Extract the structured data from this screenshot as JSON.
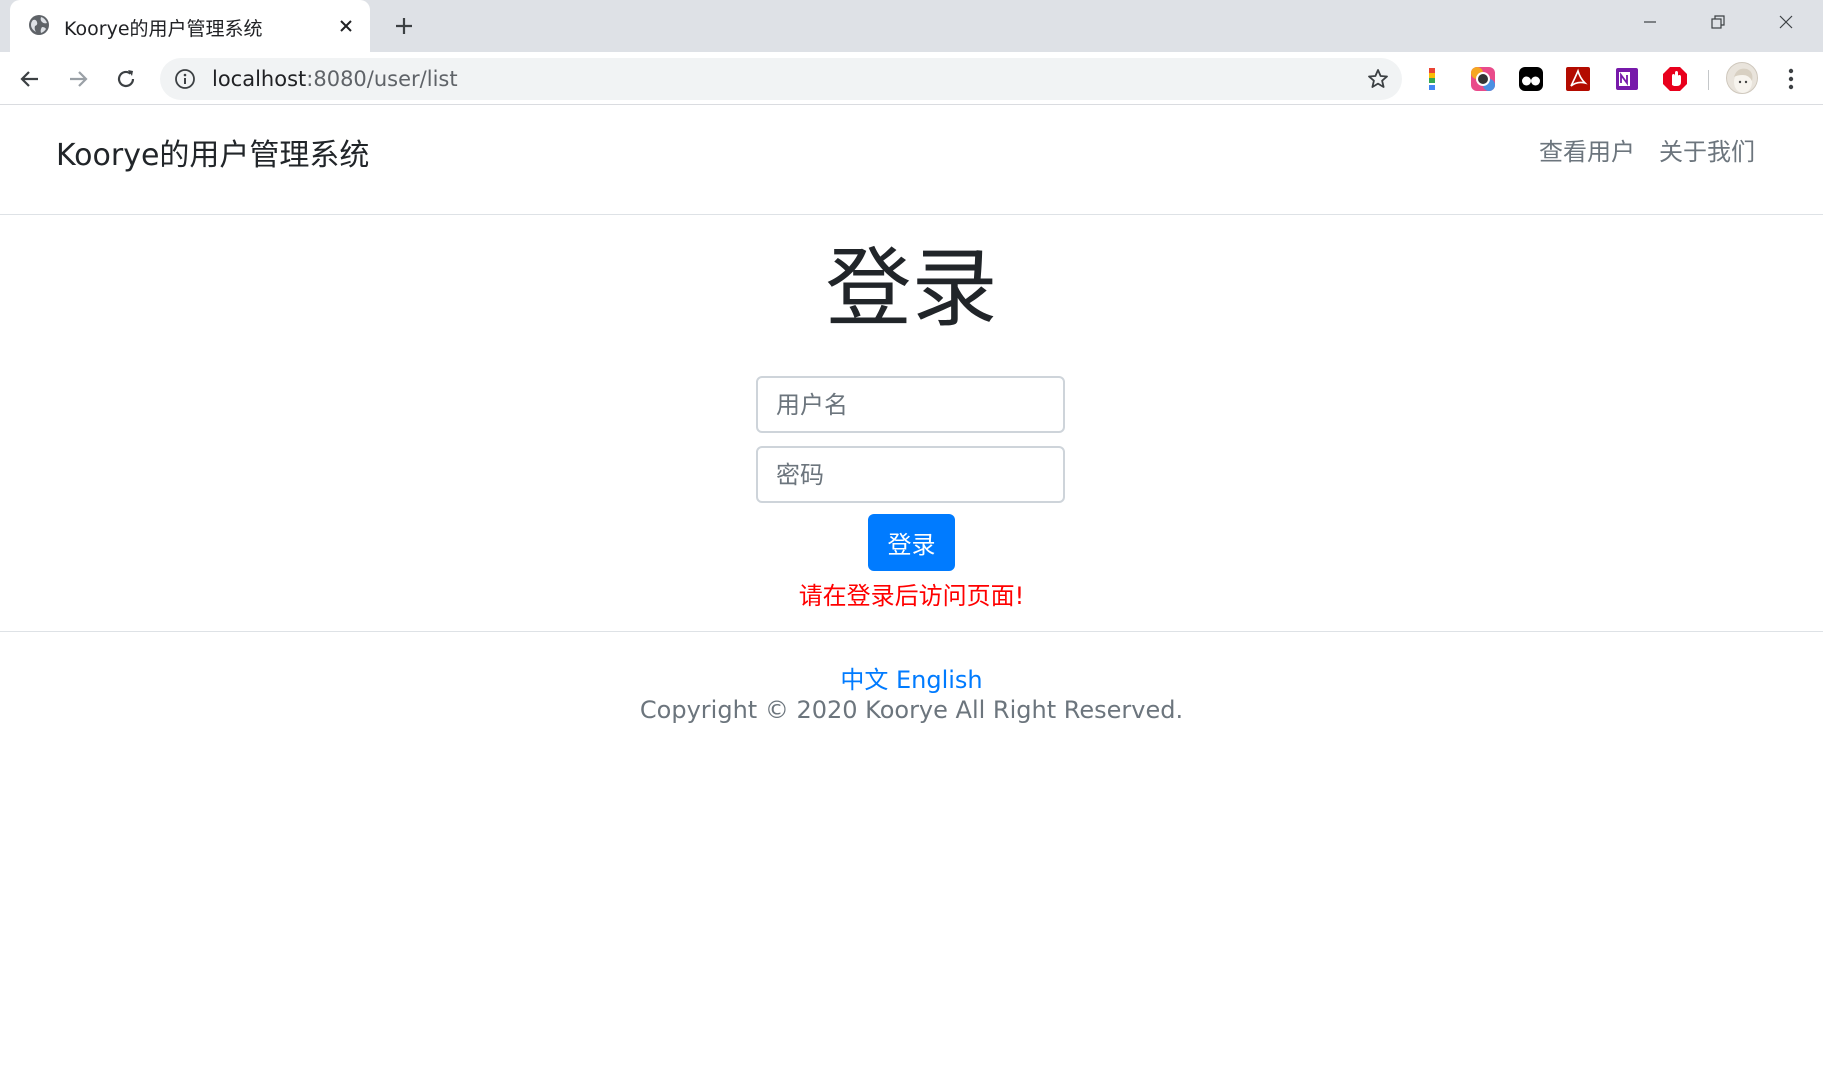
{
  "browser": {
    "tab": {
      "title": "Koorye的用户管理系统",
      "favicon": "globe-icon",
      "close_icon": "close-icon"
    },
    "new_tab_icon": "plus-icon",
    "window_controls": [
      "minimize-icon",
      "restore-icon",
      "close-window-icon"
    ],
    "nav": {
      "back": "arrow-left-icon",
      "forward": "arrow-right-icon",
      "reload": "reload-icon"
    },
    "omnibox": {
      "host": "localhost",
      "rest": ":8080/user/list",
      "info_icon": "info-icon",
      "bookmark_icon": "star-icon"
    },
    "extensions": [
      "exclamation-extension-icon",
      "color-picker-extension-icon",
      "tampermonkey-extension-icon",
      "pdf-extension-icon",
      "onenote-extension-icon",
      "adblock-extension-icon"
    ],
    "profile": "avatar",
    "menu_icon": "kebab-menu-icon"
  },
  "navbar": {
    "brand": "Koorye的用户管理系统",
    "links": [
      {
        "label": "查看用户"
      },
      {
        "label": "关于我们"
      }
    ]
  },
  "login": {
    "title": "登录",
    "username_placeholder": "用户名",
    "username_value": "",
    "password_placeholder": "密码",
    "password_value": "",
    "submit_label": "登录",
    "error": "请在登录后访问页面!"
  },
  "footer": {
    "lang_zh": "中文",
    "lang_en": "English",
    "copyright": "Copyright © 2020 Koorye All Right Reserved."
  },
  "colors": {
    "primary": "#007bff",
    "error": "#ff0000",
    "muted": "#6c757d",
    "text": "#212529",
    "chrome_bg": "#dee1e6"
  }
}
